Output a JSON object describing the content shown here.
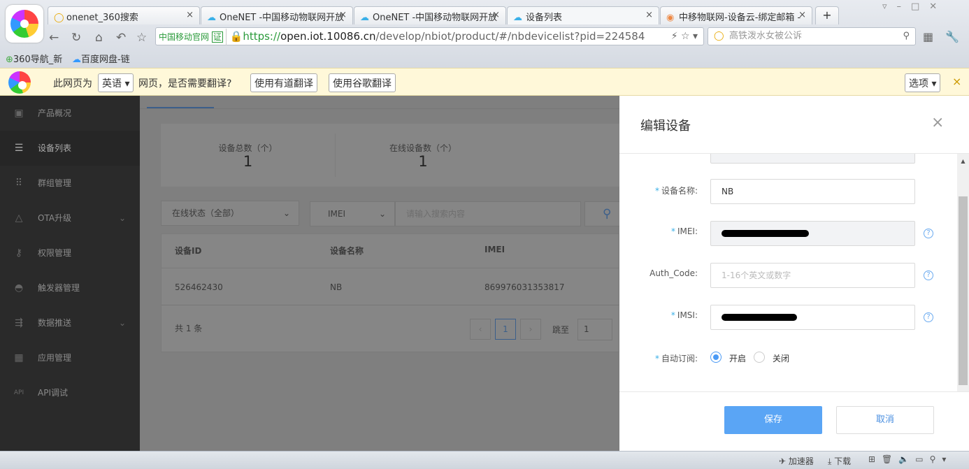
{
  "browser": {
    "tabs": [
      {
        "label": "onenet_360搜索",
        "icon": "360-search-icon"
      },
      {
        "label": "OneNET -中国移动物联网开放",
        "icon": "cloud-icon"
      },
      {
        "label": "OneNET -中国移动物联网开放",
        "icon": "cloud-icon"
      },
      {
        "label": "设备列表",
        "icon": "cloud-icon"
      },
      {
        "label": "中移物联网-设备云-绑定邮箱 -",
        "icon": "site-icon"
      }
    ],
    "new_tab": "+",
    "site_badge": "中国移动官网",
    "cert_badge": "证",
    "url_prefix": "https://",
    "url_domain": "open.iot.10086.cn",
    "url_path": "/develop/nbiot/product/#/nbdevicelist?pid=224584",
    "search_placeholder": "高铁泼水女被公诉",
    "bookmarks": [
      "360导航_新",
      "百度网盘-链"
    ]
  },
  "translate_bar": {
    "prefix": "此网页为",
    "language": "英语",
    "question": "网页，是否需要翻译?",
    "youdao": "使用有道翻译",
    "google": "使用谷歌翻译",
    "options": "选项",
    "close": "×"
  },
  "sidebar": {
    "items": [
      {
        "label": "产品概况"
      },
      {
        "label": "设备列表"
      },
      {
        "label": "群组管理"
      },
      {
        "label": "OTA升级"
      },
      {
        "label": "权限管理"
      },
      {
        "label": "触发器管理"
      },
      {
        "label": "数据推送"
      },
      {
        "label": "应用管理"
      },
      {
        "label": "API调试"
      }
    ]
  },
  "stats": {
    "total_label": "设备总数（个）",
    "total": "1",
    "online_label": "在线设备数（个）",
    "online": "1"
  },
  "filters": {
    "status": "在线状态（全部）",
    "field": "IMEI",
    "search_placeholder": "请输入搜索内容"
  },
  "table": {
    "headers": [
      "设备ID",
      "设备名称",
      "IMEI"
    ],
    "rows": [
      [
        "526462430",
        "NB",
        "869976031353817"
      ]
    ]
  },
  "pagination": {
    "total": "共 1 条",
    "current": "1",
    "jump_label": "跳至",
    "jump_value": "1"
  },
  "modal": {
    "title": "编辑设备",
    "close": "×",
    "name_label": "设备名称:",
    "name_value": "NB",
    "imei_label": "IMEI:",
    "auth_label": "Auth_Code:",
    "auth_placeholder": "1-16个英文或数字",
    "imsi_label": "IMSI:",
    "sub_label": "自动订阅:",
    "sub_on": "开启",
    "sub_off": "关闭",
    "save": "保存",
    "cancel": "取消"
  },
  "statusbar": {
    "accelerator": "加速器",
    "download": "下载"
  }
}
